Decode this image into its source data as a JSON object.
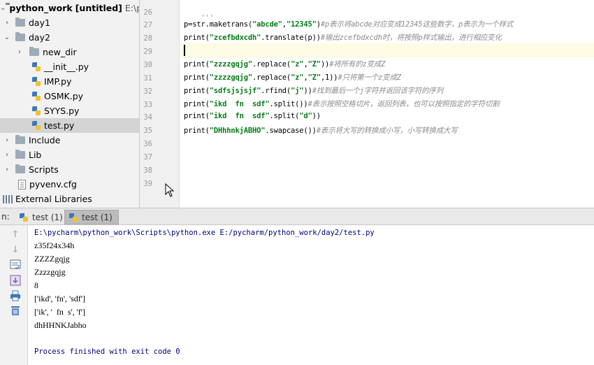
{
  "project": {
    "root_name": "python_work",
    "root_tag": "[untitled]",
    "root_path": "E:\\pyc",
    "items": [
      {
        "label": "day1",
        "arrow": "›",
        "kind": "folder"
      },
      {
        "label": "day2",
        "arrow": "⌄",
        "kind": "folder"
      },
      {
        "label": "new_dir",
        "arrow": "›",
        "kind": "folder"
      },
      {
        "label": "__init__.py",
        "arrow": "",
        "kind": "py"
      },
      {
        "label": "IMP.py",
        "arrow": "",
        "kind": "py"
      },
      {
        "label": "OSMK.py",
        "arrow": "",
        "kind": "py"
      },
      {
        "label": "SYYS.py",
        "arrow": "",
        "kind": "py"
      },
      {
        "label": "test.py",
        "arrow": "",
        "kind": "py"
      },
      {
        "label": "Include",
        "arrow": "›",
        "kind": "folder"
      },
      {
        "label": "Lib",
        "arrow": "›",
        "kind": "folder"
      },
      {
        "label": "Scripts",
        "arrow": "›",
        "kind": "folder"
      },
      {
        "label": "pyvenv.cfg",
        "arrow": "",
        "kind": "cfg"
      },
      {
        "label": "External Libraries",
        "arrow": "",
        "kind": "lib"
      }
    ]
  },
  "editor": {
    "line_numbers": [
      "26",
      "27",
      "28",
      "29",
      "30",
      "31",
      "32",
      "33",
      "34",
      "35",
      "36",
      "37",
      "38",
      "39"
    ],
    "lines": {
      "l26": "'''",
      "l27a": "p=str.maketrans(",
      "l27b": "\"abcde\"",
      "l27c": ",",
      "l27d": "\"12345\"",
      "l27e": ")",
      "l27f": "#p表示将abcde对应变成12345这些数字，p表示为一个样式",
      "l28a": "print(",
      "l28b": "\"zcefbdxcdh\"",
      "l28c": ".translate(p))",
      "l28d": "#输出zcefbdxcdh时，将按照p样式输出，进行相应变化",
      "l30a": "print(",
      "l30b": "\"zzzzgqjg\"",
      "l30c": ".replace(",
      "l30d": "\"z\"",
      "l30e": ",",
      "l30f": "\"Z\"",
      "l30g": "))",
      "l30h": "#将所有的z变成Z",
      "l31a": "print(",
      "l31b": "\"zzzzgqjg\"",
      "l31c": ".replace(",
      "l31d": "\"z\"",
      "l31e": ",",
      "l31f": "\"Z\"",
      "l31g": ",1))",
      "l31h": "#只将第一个z变成Z",
      "l32a": "print(",
      "l32b": "\"sdfsjsjsjf\"",
      "l32c": ".rfind(",
      "l32d": "\"j\"",
      "l32e": "))",
      "l32f": "#找到最后一个j字符并返回该字符的序列",
      "l33a": "print(",
      "l33b": "\"ikd  fn  sdf\"",
      "l33c": ".split())",
      "l33d": "#表示按照空格切片，返回列表，也可以按照指定的字符切割",
      "l34a": "print(",
      "l34b": "\"ikd  fn  sdf\"",
      "l34c": ".split(",
      "l34d": "\"d\"",
      "l34e": "))",
      "l35a": "print(",
      "l35b": "\"DHhhnkjABHO\"",
      "l35c": ".swapcase())",
      "l35d": "#表示将大写的转换成小写，小写转换成大写"
    }
  },
  "run": {
    "label": "n:",
    "tabs": [
      "test (1)",
      "test (1)"
    ],
    "output": [
      "E:\\pycharm\\python_work\\Scripts\\python.exe E:/pycharm/python_work/day2/test.py",
      "z35f24x34h",
      "ZZZZgqjg",
      "Zzzzgqjg",
      "8",
      "['ikd', 'fn', 'sdf']",
      "['ik', '  fn  s', 'f']",
      "dhHHNKJabho",
      "",
      "Process finished with exit code 0"
    ]
  },
  "colors": {
    "string": "#067d17",
    "comment": "#8c8c8c",
    "console_cmd": "#000080",
    "selection": "#d4d4d4"
  }
}
